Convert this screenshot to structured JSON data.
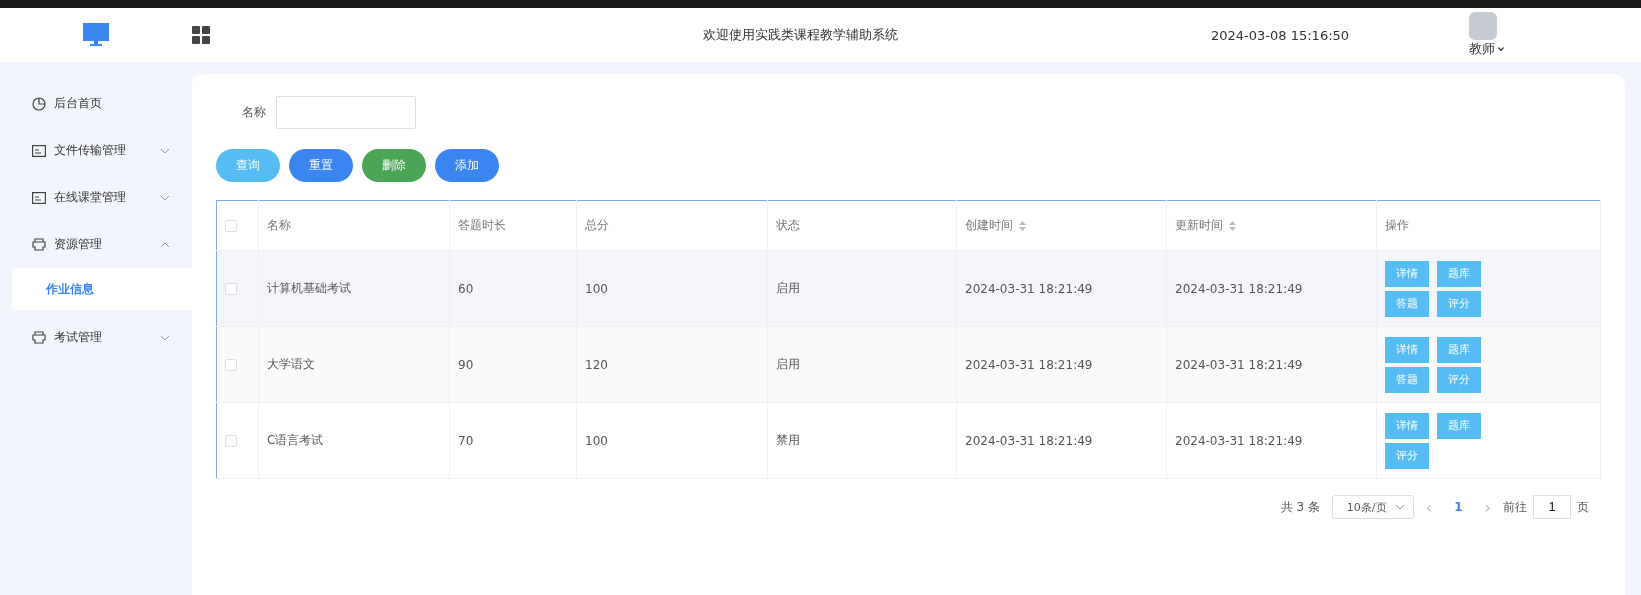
{
  "header": {
    "title": "欢迎使用实践类课程教学辅助系统",
    "datetime": "2024-03-08 15:16:50",
    "user": "教师"
  },
  "sidebar": {
    "items": [
      {
        "label": "后台首页",
        "kind": "link"
      },
      {
        "label": "文件传输管理",
        "kind": "group",
        "expanded": false
      },
      {
        "label": "在线课堂管理",
        "kind": "group",
        "expanded": false
      },
      {
        "label": "资源管理",
        "kind": "group",
        "expanded": true,
        "children": [
          {
            "label": "作业信息",
            "selected": true
          }
        ]
      },
      {
        "label": "考试管理",
        "kind": "group",
        "expanded": false
      }
    ]
  },
  "search": {
    "label": "名称"
  },
  "buttons": [
    {
      "label": "查询",
      "color": "#56bdf4"
    },
    {
      "label": "重置",
      "color": "#3a85f0"
    },
    {
      "label": "删除",
      "color": "#4aa557"
    },
    {
      "label": "添加",
      "color": "#3a85f0"
    }
  ],
  "table": {
    "select_all_checked": false,
    "columns": [
      {
        "label": "名称",
        "sortable": false
      },
      {
        "label": "答题时长",
        "sortable": false
      },
      {
        "label": "总分",
        "sortable": false
      },
      {
        "label": "状态",
        "sortable": false
      },
      {
        "label": "创建时间",
        "sortable": true
      },
      {
        "label": "更新时间",
        "sortable": true
      },
      {
        "label": "操作",
        "sortable": false
      }
    ],
    "rows": [
      {
        "checked": false,
        "cells": [
          "计算机基础考试",
          "60",
          "100",
          "启用",
          "2024-03-31 18:21:49",
          "2024-03-31 18:21:49"
        ],
        "actions": [
          "详情",
          "题库",
          "答题",
          "评分"
        ]
      },
      {
        "checked": false,
        "cells": [
          "大学语文",
          "90",
          "120",
          "启用",
          "2024-03-31 18:21:49",
          "2024-03-31 18:21:49"
        ],
        "actions": [
          "详情",
          "题库",
          "答题",
          "评分"
        ]
      },
      {
        "checked": false,
        "cells": [
          "C语言考试",
          "70",
          "100",
          "禁用",
          "2024-03-31 18:21:49",
          "2024-03-31 18:21:49"
        ],
        "actions": [
          "详情",
          "题库",
          "评分"
        ]
      }
    ]
  },
  "pagination": {
    "total": "共 3 条",
    "page_size": "10条/页",
    "prev": "‹",
    "pages": [
      {
        "label": "1",
        "selected": true
      }
    ],
    "next": "›",
    "goto_label": "前往",
    "goto_value": "1",
    "goto_suffix": "页"
  }
}
